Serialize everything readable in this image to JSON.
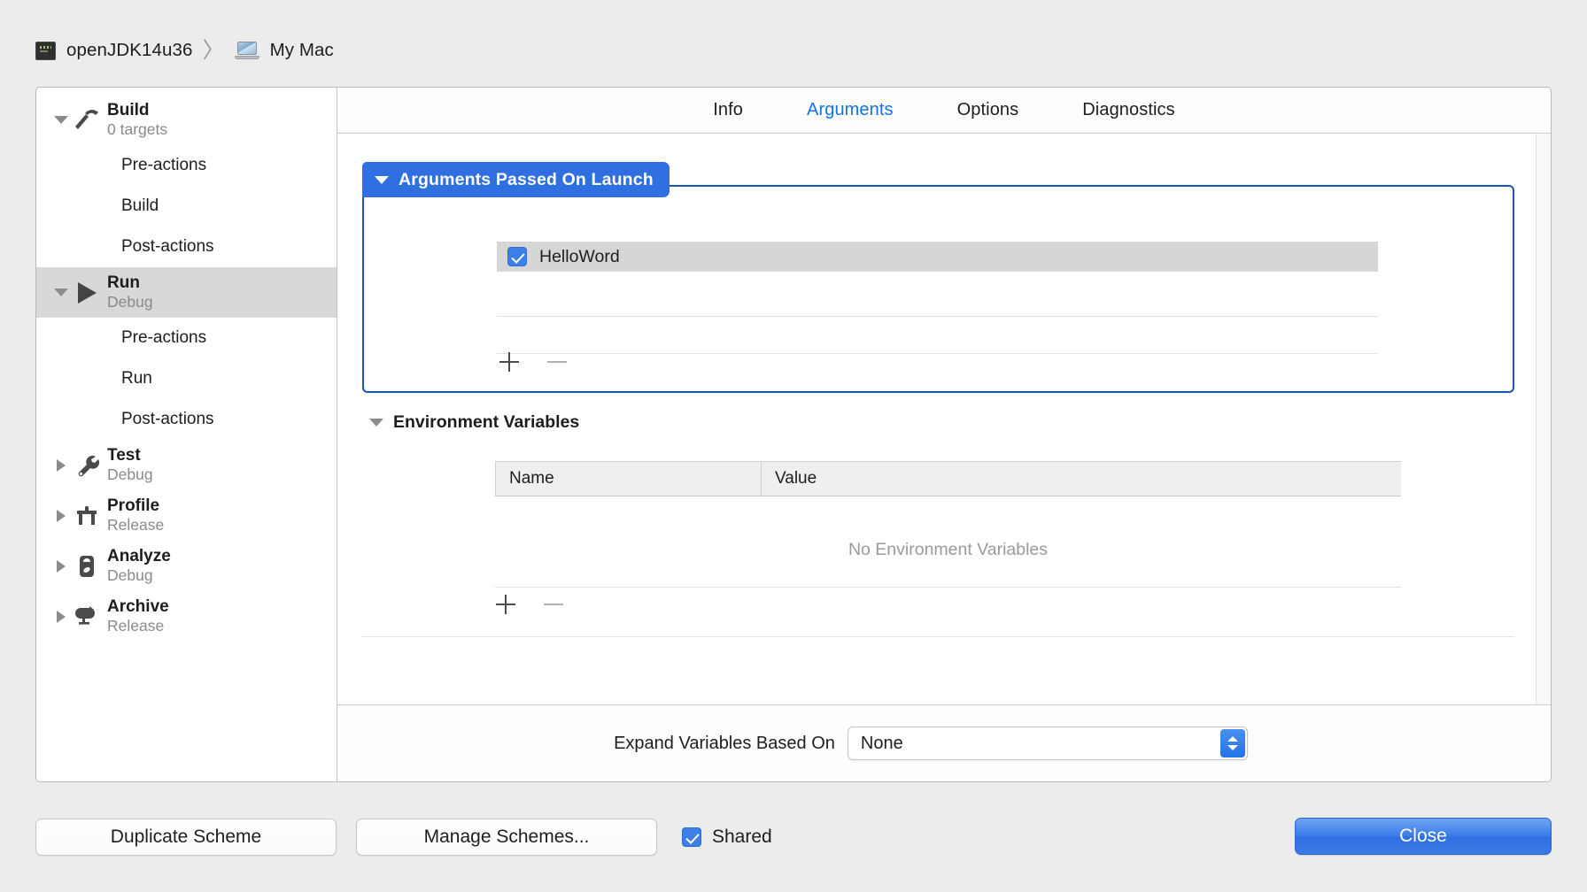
{
  "breadcrumb": {
    "scheme_icon": "console-icon",
    "scheme_name": "openJDK14u36",
    "separator": "〉",
    "destination_icon": "laptop-icon",
    "destination_name": "My Mac"
  },
  "sidebar": {
    "items": [
      {
        "type": "group",
        "label": "Build",
        "subtitle": "0 targets",
        "icon": "hammer-icon",
        "expanded": true,
        "selected": false
      },
      {
        "type": "child",
        "label": "Pre-actions"
      },
      {
        "type": "child",
        "label": "Build"
      },
      {
        "type": "child",
        "label": "Post-actions"
      },
      {
        "type": "group",
        "label": "Run",
        "subtitle": "Debug",
        "icon": "play-icon",
        "expanded": true,
        "selected": true
      },
      {
        "type": "child",
        "label": "Pre-actions"
      },
      {
        "type": "child",
        "label": "Run"
      },
      {
        "type": "child",
        "label": "Post-actions"
      },
      {
        "type": "group",
        "label": "Test",
        "subtitle": "Debug",
        "icon": "wrench-icon",
        "expanded": false,
        "selected": false
      },
      {
        "type": "group",
        "label": "Profile",
        "subtitle": "Release",
        "icon": "caliper-icon",
        "expanded": false,
        "selected": false
      },
      {
        "type": "group",
        "label": "Analyze",
        "subtitle": "Debug",
        "icon": "analyze-icon",
        "expanded": false,
        "selected": false
      },
      {
        "type": "group",
        "label": "Archive",
        "subtitle": "Release",
        "icon": "archive-icon",
        "expanded": false,
        "selected": false
      }
    ]
  },
  "tabs": [
    {
      "label": "Info",
      "active": false
    },
    {
      "label": "Arguments",
      "active": true
    },
    {
      "label": "Options",
      "active": false
    },
    {
      "label": "Diagnostics",
      "active": false
    }
  ],
  "arguments_section": {
    "header": "Arguments Passed On Launch",
    "expanded": true,
    "focused": true,
    "rows": [
      {
        "value": "HelloWord",
        "checked": true,
        "selected": true
      }
    ],
    "add_button": "add-argument-button",
    "remove_button": "remove-argument-button",
    "remove_enabled": false
  },
  "environment_section": {
    "header": "Environment Variables",
    "expanded": true,
    "columns": [
      "Name",
      "Value"
    ],
    "rows": [],
    "empty_text": "No Environment Variables",
    "add_button": "add-environment-variable-button",
    "remove_button": "remove-environment-variable-button",
    "remove_enabled": false
  },
  "expand_variables": {
    "label": "Expand Variables Based On",
    "value": "None"
  },
  "footer": {
    "duplicate_scheme": "Duplicate Scheme",
    "manage_schemes": "Manage Schemes...",
    "shared_label": "Shared",
    "shared_checked": true,
    "close": "Close"
  },
  "colors": {
    "accent": "#2f6fe0",
    "tab_active": "#1273e0",
    "focus_ring": "#1558b0",
    "selected_row": "#d6d6d6",
    "muted_text": "#8a8a8e"
  }
}
